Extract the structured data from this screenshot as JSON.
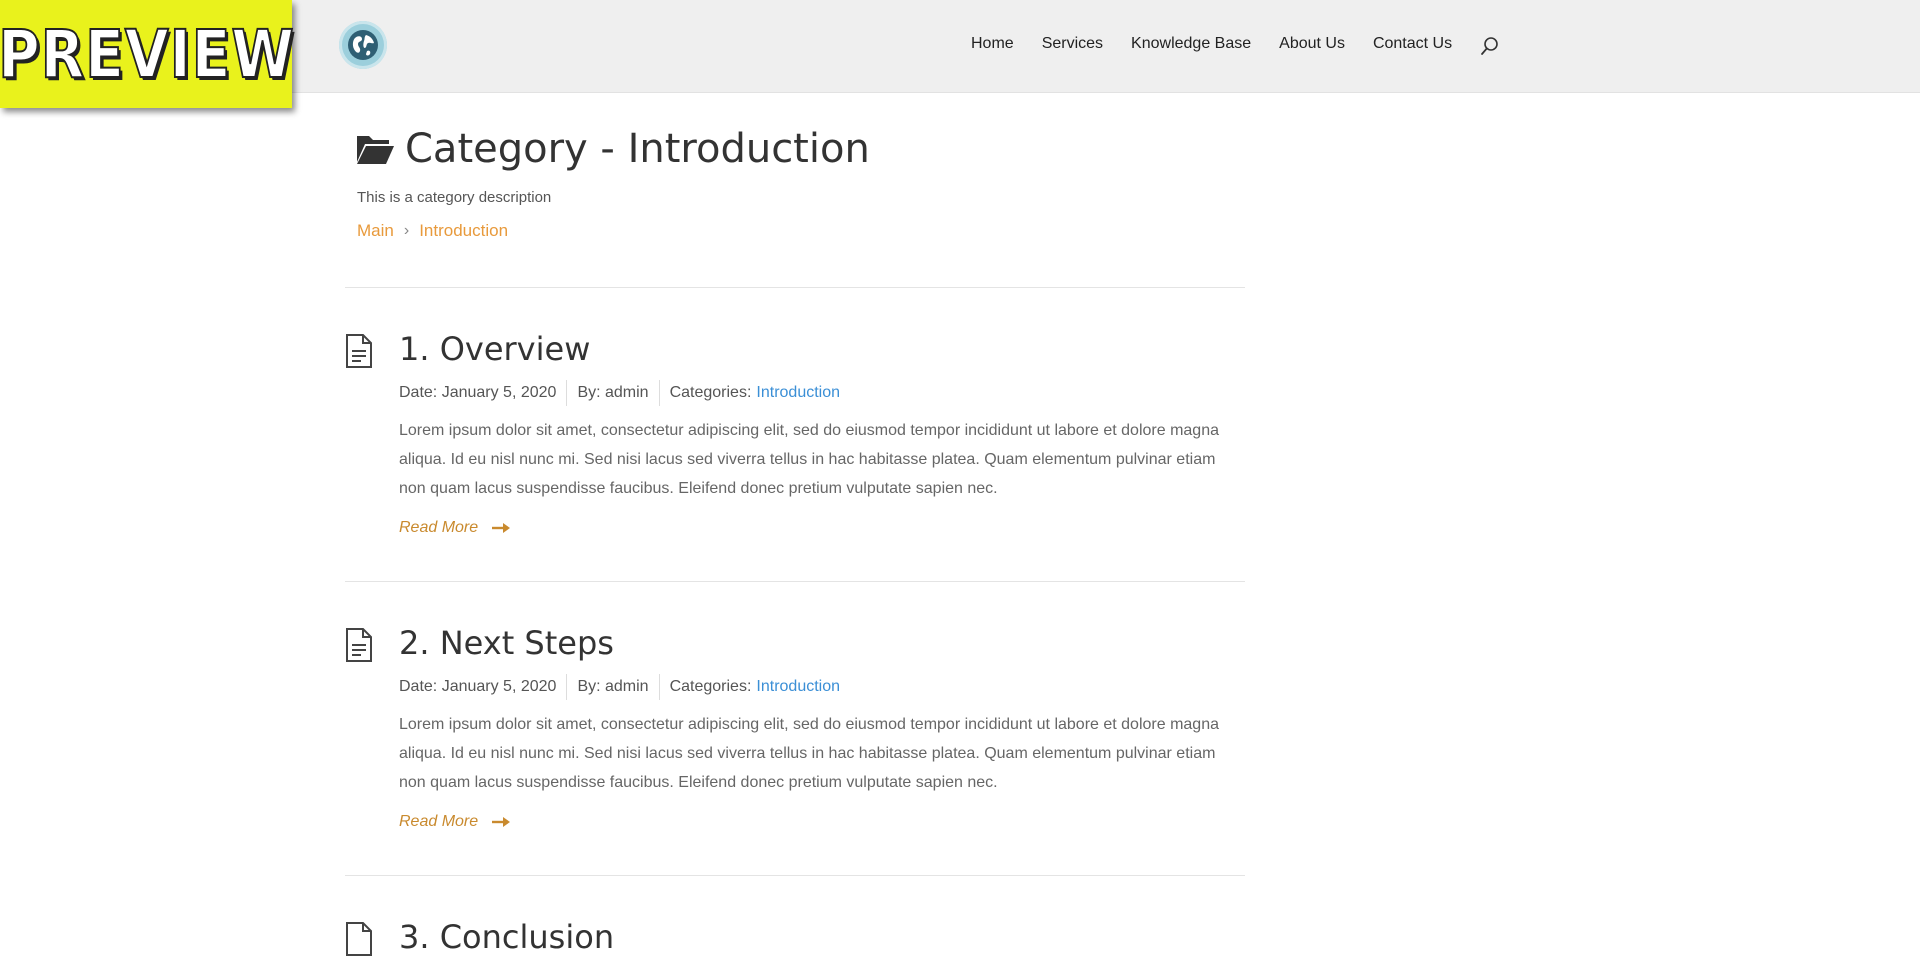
{
  "badge": {
    "label": "PREVIEW"
  },
  "nav": {
    "items": [
      "Home",
      "Services",
      "Knowledge Base",
      "About Us",
      "Contact Us"
    ]
  },
  "category": {
    "title": "Category - Introduction",
    "description": "This is a category description",
    "breadcrumb": [
      "Main",
      "Introduction"
    ]
  },
  "articles": [
    {
      "title": "1. Overview",
      "date": "Date: January 5, 2020",
      "author": "By: admin",
      "categories_label": "Categories:",
      "category": "Introduction",
      "excerpt": "Lorem ipsum dolor sit amet, consectetur adipiscing elit, sed do eiusmod tempor incididunt ut labore et dolore magna aliqua. Id eu nisl nunc mi. Sed nisi lacus sed viverra tellus in hac habitasse platea. Quam elementum pulvinar etiam non quam lacus suspendisse faucibus. Eleifend donec pretium vulputate sapien nec.",
      "read_more": "Read More"
    },
    {
      "title": "2. Next Steps",
      "date": "Date: January 5, 2020",
      "author": "By: admin",
      "categories_label": "Categories:",
      "category": "Introduction",
      "excerpt": "Lorem ipsum dolor sit amet, consectetur adipiscing elit, sed do eiusmod tempor incididunt ut labore et dolore magna aliqua. Id eu nisl nunc mi. Sed nisi lacus sed viverra tellus in hac habitasse platea. Quam elementum pulvinar etiam non quam lacus suspendisse faucibus. Eleifend donec pretium vulputate sapien nec.",
      "read_more": "Read More"
    },
    {
      "title": "3. Conclusion"
    }
  ],
  "colors": {
    "accent_orange": "#e89a3c",
    "link_blue": "#3b8fd6",
    "read_more": "#c98a2e",
    "header_bg": "#efefef",
    "badge_bg": "#e9f21c"
  }
}
